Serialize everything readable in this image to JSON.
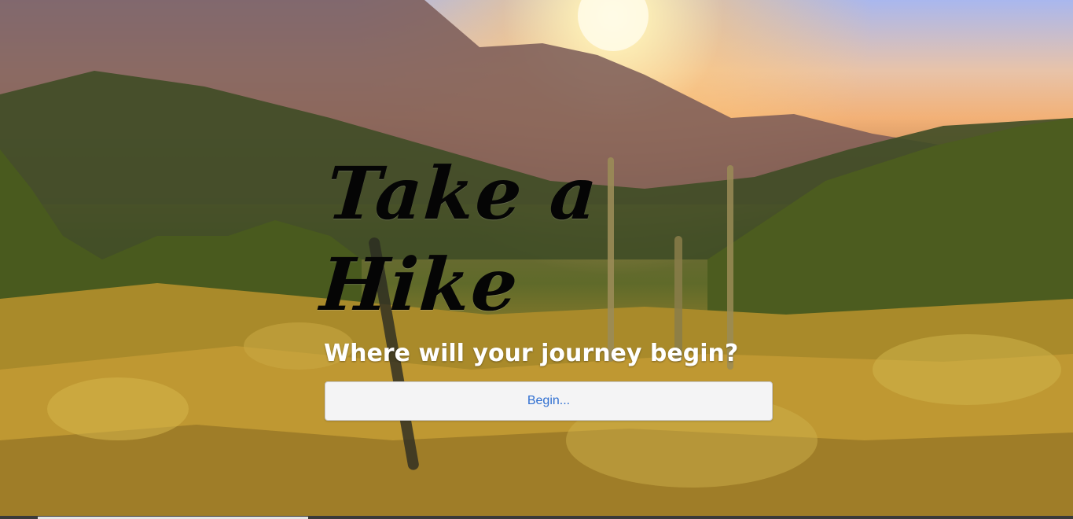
{
  "hero": {
    "title": "Take a Hike",
    "subtitle": "Where will your journey begin?",
    "begin_button": "Begin..."
  },
  "colors": {
    "title": "#050505",
    "subtitle": "#ffffff",
    "button_background": "#f4f4f5",
    "button_text": "#2f6fd1"
  }
}
